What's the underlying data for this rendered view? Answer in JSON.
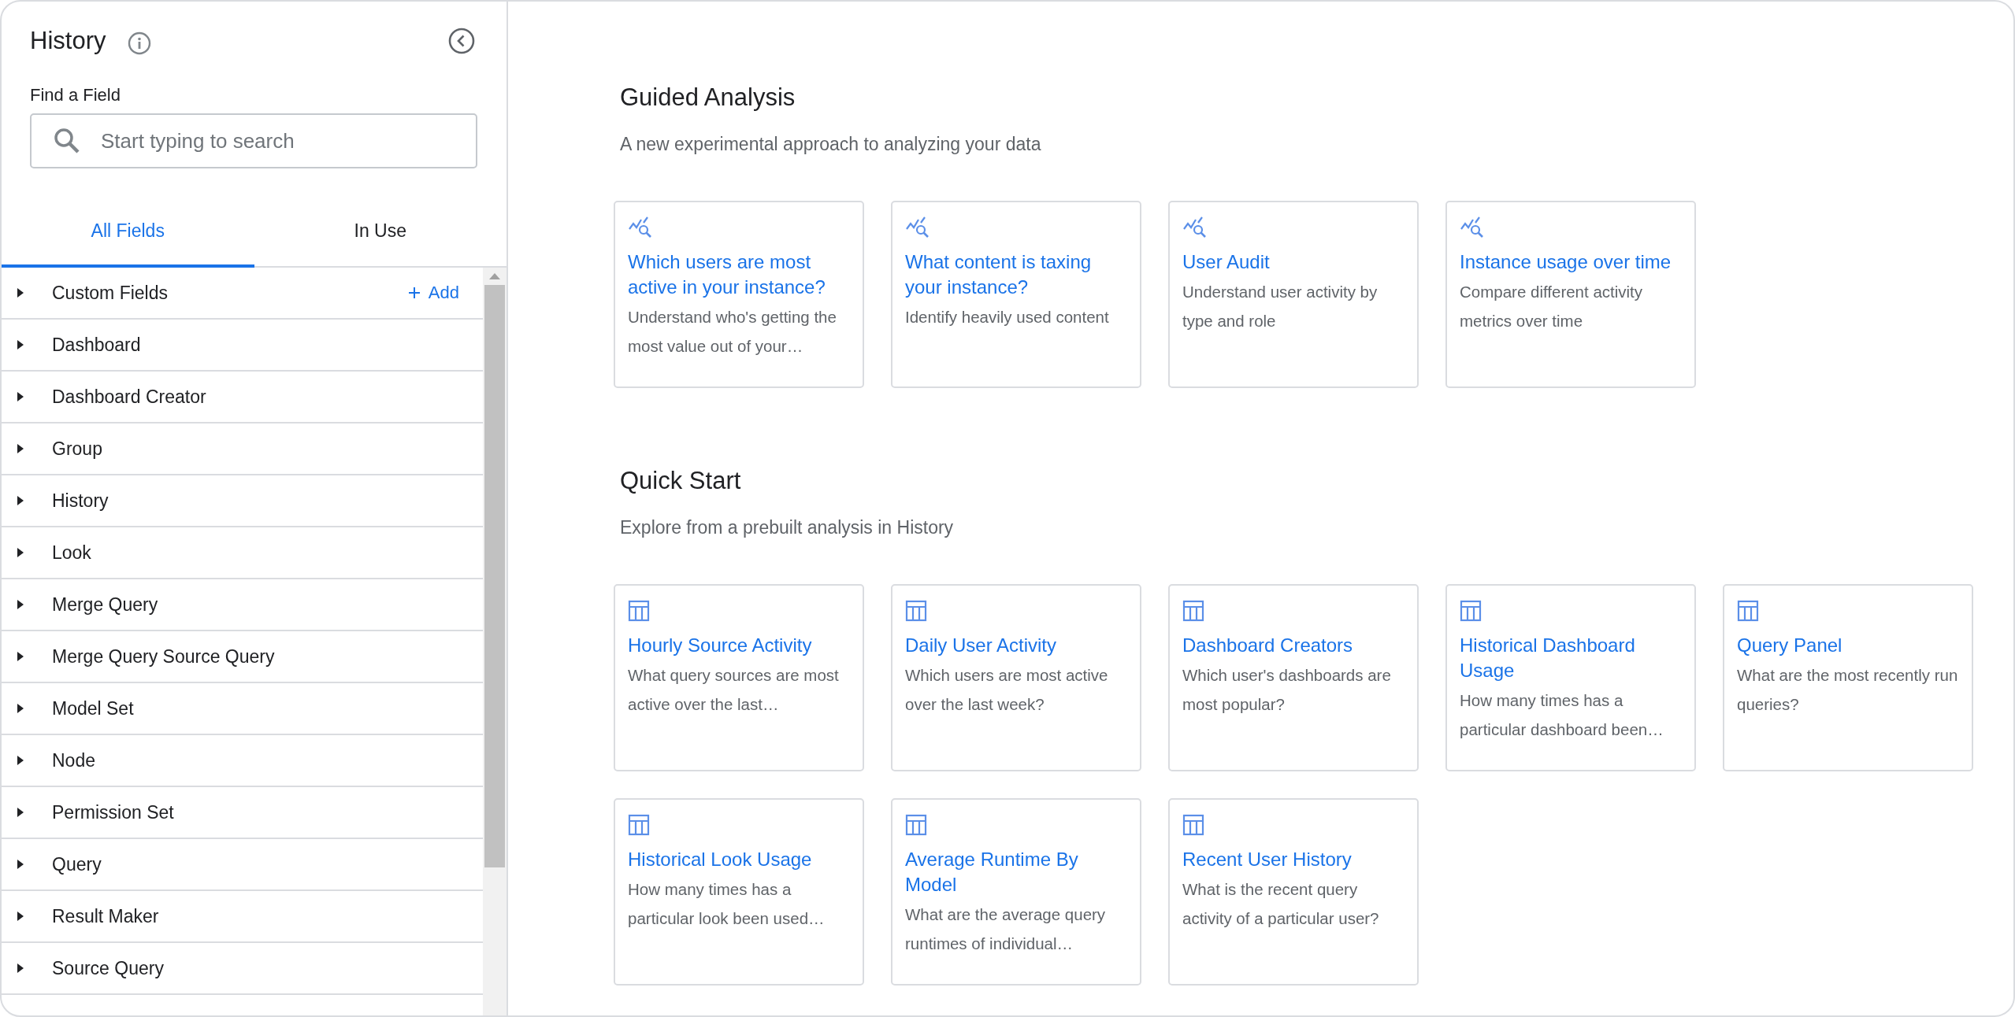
{
  "sidebar": {
    "title": "History",
    "search": {
      "label": "Find a Field",
      "placeholder": "Start typing to search"
    },
    "tabs": [
      {
        "label": "All Fields",
        "selected": true
      },
      {
        "label": "In Use",
        "selected": false
      }
    ],
    "items": [
      {
        "label": "Custom Fields",
        "expanded": false,
        "action": "Add"
      },
      {
        "label": "Dashboard",
        "expanded": false
      },
      {
        "label": "Dashboard Creator",
        "expanded": false
      },
      {
        "label": "Group",
        "expanded": false
      },
      {
        "label": "History",
        "expanded": false
      },
      {
        "label": "Look",
        "expanded": false
      },
      {
        "label": "Merge Query",
        "expanded": false
      },
      {
        "label": "Merge Query Source Query",
        "expanded": false
      },
      {
        "label": "Model Set",
        "expanded": false
      },
      {
        "label": "Node",
        "expanded": false
      },
      {
        "label": "Permission Set",
        "expanded": false
      },
      {
        "label": "Query",
        "expanded": false
      },
      {
        "label": "Result Maker",
        "expanded": false
      },
      {
        "label": "Source Query",
        "expanded": false
      }
    ]
  },
  "sections": [
    {
      "kind": "guided",
      "title": "Guided Analysis",
      "subtitle": "A new experimental approach to analyzing your data",
      "cards": [
        {
          "title": "Which users are most active in your instance?",
          "description": "Understand who's getting the most value out of your…"
        },
        {
          "title": "What content is taxing your instance?",
          "description": "Identify heavily used content"
        },
        {
          "title": "User Audit",
          "description": "Understand user activity by type and role"
        },
        {
          "title": "Instance usage over time",
          "description": "Compare different activity metrics over time"
        }
      ]
    },
    {
      "kind": "quick",
      "title": "Quick Start",
      "subtitle": "Explore from a prebuilt analysis in History",
      "cards": [
        {
          "title": "Hourly Source Activity",
          "description": "What query sources are most active over the last…"
        },
        {
          "title": "Daily User Activity",
          "description": "Which users are most active over the last week?"
        },
        {
          "title": "Dashboard Creators",
          "description": "Which user's dashboards are most popular?"
        },
        {
          "title": "Historical Dashboard Usage",
          "description": "How many times has a particular dashboard been…"
        },
        {
          "title": "Query Panel",
          "description": "What are the most recently run queries?"
        },
        {
          "title": "Historical Look Usage",
          "description": "How many times has a particular look been used…"
        },
        {
          "title": "Average Runtime By Model",
          "description": "What are the average query runtimes of individual…"
        },
        {
          "title": "Recent User History",
          "description": "What is the recent query activity of a particular user?"
        }
      ]
    }
  ]
}
